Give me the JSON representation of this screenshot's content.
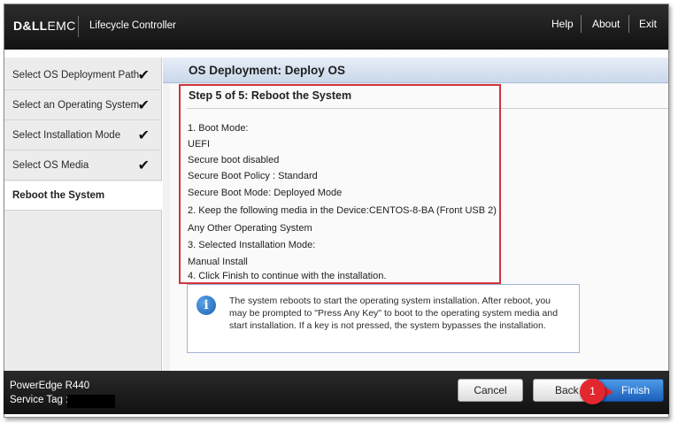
{
  "header": {
    "logo_brand": "D&LL",
    "logo_suffix": "EMC",
    "app_title": "Lifecycle Controller",
    "links": [
      "Help",
      "About",
      "Exit"
    ]
  },
  "sidebar": {
    "items": [
      {
        "label": "Select OS Deployment Path",
        "checked": true
      },
      {
        "label": "Select an Operating System",
        "checked": true
      },
      {
        "label": "Select Installation Mode",
        "checked": true
      },
      {
        "label": "Select OS Media",
        "checked": true
      },
      {
        "label": "Reboot the System",
        "checked": false,
        "active": true
      }
    ],
    "check_glyph": "✔"
  },
  "main": {
    "title": "OS Deployment: Deploy OS",
    "step_title": "Step 5 of 5: Reboot the System",
    "lines": [
      "1. Boot Mode:",
      "UEFI",
      "Secure boot disabled",
      "Secure Boot Policy : Standard",
      "Secure Boot Mode: Deployed Mode",
      "2. Keep the following media in the Device:CENTOS-8-BA (Front USB 2)",
      "Any Other Operating System",
      "3. Selected Installation Mode:",
      "Manual Install",
      "4. Click Finish to continue with the installation."
    ],
    "info_icon": "i",
    "info_text": "The system reboots to start the operating system installation. After reboot, you may be prompted to \"Press Any Key\" to boot to the operating system media and start installation. If a key is not pressed, the system bypasses the installation."
  },
  "footer": {
    "model": "PowerEdge R440",
    "service_tag_label": "Service Tag :",
    "buttons": {
      "cancel": "Cancel",
      "back": "Back",
      "finish": "Finish"
    },
    "callout_number": "1"
  },
  "colors": {
    "accent_blue": "#1a5fba",
    "highlight_red": "#d0343c",
    "callout_red": "#e2272f"
  }
}
